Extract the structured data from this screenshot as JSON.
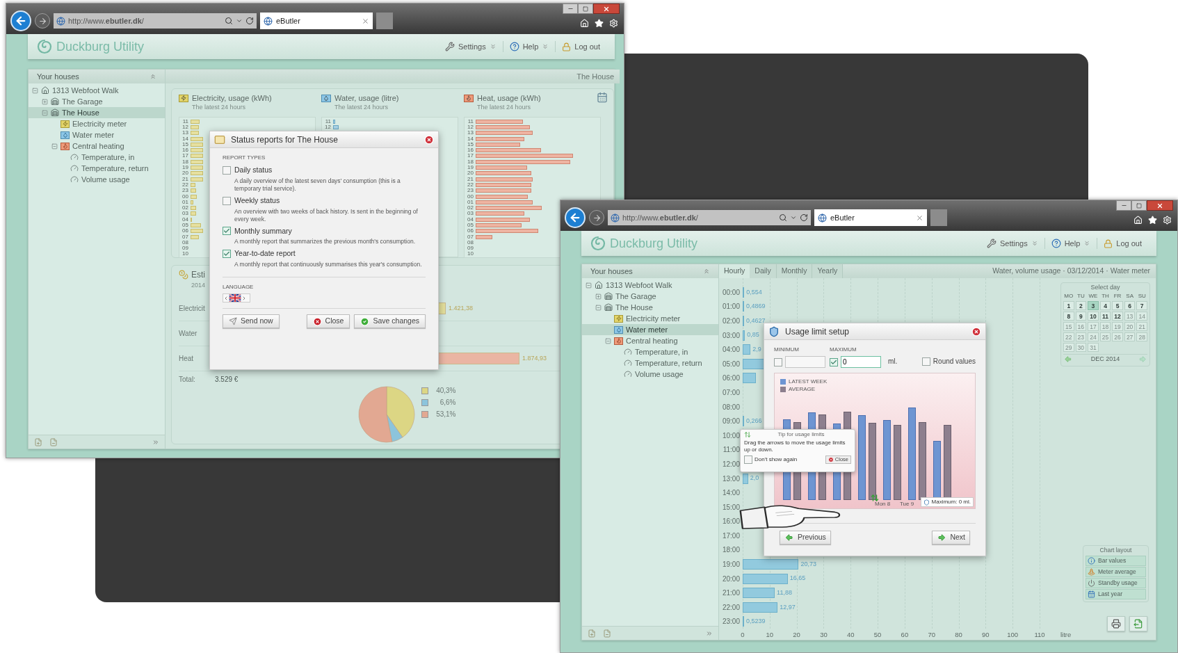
{
  "window_1": {
    "browser": {
      "address": "http://www.**ebutler.dk**/",
      "tab": "eButler"
    },
    "header": {
      "logo": "Duckburg Utility",
      "menu": [
        {
          "label": "Settings",
          "kind": "settings",
          "dropdown": true
        },
        {
          "label": "Help",
          "kind": "help",
          "dropdown": true
        },
        {
          "label": "Log out",
          "kind": "logout",
          "dropdown": false
        }
      ]
    },
    "sidebar": {
      "title": "Your houses",
      "tree": [
        {
          "label": "1313 Webfoot Walk",
          "kind": "house",
          "expanded": true,
          "selected": false,
          "children": [
            {
              "label": "The Garage",
              "kind": "building",
              "expanded": false,
              "selected": false
            },
            {
              "label": "The House",
              "kind": "building",
              "expanded": true,
              "selected": true,
              "children": [
                {
                  "label": "Electricity meter",
                  "kind": "electricity",
                  "selected": false
                },
                {
                  "label": "Water meter",
                  "kind": "water",
                  "selected": false
                },
                {
                  "label": "Central heating",
                  "kind": "heating",
                  "expanded": true,
                  "selected": false,
                  "children": [
                    {
                      "label": "Temperature, in",
                      "kind": "sensor",
                      "selected": false
                    },
                    {
                      "label": "Temperature, return",
                      "kind": "sensor",
                      "selected": false
                    },
                    {
                      "label": "Volume usage",
                      "kind": "sensor",
                      "selected": false
                    }
                  ]
                }
              ]
            }
          ]
        }
      ]
    },
    "title": "The House",
    "usage_charts": [
      {
        "title": "Electricity, usage (kWh)",
        "subtitle": "The latest 24 hours",
        "kind": "electricity",
        "hours": [
          "11",
          "12",
          "13",
          "14",
          "15",
          "16",
          "17",
          "18",
          "19",
          "20",
          "21",
          "22",
          "23",
          "00",
          "01",
          "02",
          "03",
          "04",
          "05",
          "06",
          "07",
          "08",
          "09",
          "10"
        ]
      },
      {
        "title": "Water, usage (litre)",
        "subtitle": "The latest 24 hours",
        "kind": "water",
        "hours": [
          "11",
          "12"
        ]
      },
      {
        "title": "Heat, usage (kWh)",
        "subtitle": "The latest 24 hours",
        "kind": "heat",
        "hours": [
          "11",
          "12",
          "13",
          "14",
          "15",
          "16",
          "17",
          "18",
          "19",
          "20",
          "21",
          "22",
          "23",
          "00",
          "01",
          "02",
          "03",
          "04",
          "05",
          "06",
          "07",
          "08",
          "09",
          "10"
        ]
      }
    ],
    "estimate": {
      "title": "Esti",
      "year": "2014",
      "chart_data": {
        "type": "bar",
        "orientation": "horizontal",
        "categories": [
          "Electricit",
          "Water",
          "Heat"
        ],
        "values": [
          1421.38,
          null,
          1874.93
        ],
        "value_labels": [
          "1.421,38",
          null,
          "1.874,93"
        ],
        "colors": [
          "#e3df9c",
          null,
          "#eab5a3"
        ]
      },
      "total_label": "Total:",
      "total": "3.529 €",
      "pie": {
        "chart_data": {
          "type": "pie",
          "categories": [
            "40,3%",
            "6,6%",
            "53,1%"
          ],
          "values": [
            40.3,
            6.6,
            53.1
          ],
          "legend": "right",
          "colors": [
            "#dcd684",
            "#8cc4dc",
            "#e2a892"
          ]
        }
      }
    },
    "dialog": {
      "title": "Status reports for The House",
      "section": "REPORT TYPES",
      "options": [
        {
          "label": "Daily status",
          "description": "A daily overview of the latest seven days' consumption (this is a temporary trial service).",
          "checked": false
        },
        {
          "label": "Weekly status",
          "description": "An overview with two weeks of back history. Is sent in the beginning of every week.",
          "checked": false
        },
        {
          "label": "Monthly summary",
          "description": "A monthly report that summarizes the previous month's consumption.",
          "checked": true
        },
        {
          "label": "Year-to-date report",
          "description": "A monthly report that continuously summarises this year's consumption.",
          "checked": true
        }
      ],
      "language_label": "LANGUAGE",
      "buttons": [
        {
          "label": "Send now",
          "kind": "send"
        },
        {
          "label": "Close",
          "kind": "close"
        },
        {
          "label": "Save changes",
          "kind": "save"
        }
      ]
    }
  },
  "window_2": {
    "browser": {
      "address": "http://www.**ebutler.dk**/",
      "tab": "eButler"
    },
    "header": {
      "logo": "Duckburg Utility",
      "menu": [
        {
          "label": "Settings",
          "kind": "settings",
          "dropdown": true
        },
        {
          "label": "Help",
          "kind": "help",
          "dropdown": true
        },
        {
          "label": "Log out",
          "kind": "logout",
          "dropdown": false
        }
      ]
    },
    "sidebar": {
      "title": "Your houses",
      "tree": [
        {
          "label": "1313 Webfoot Walk",
          "kind": "house",
          "expanded": true,
          "selected": false,
          "children": [
            {
              "label": "The Garage",
              "kind": "building",
              "expanded": false,
              "selected": false
            },
            {
              "label": "The House",
              "kind": "building",
              "expanded": true,
              "selected": false,
              "children": [
                {
                  "label": "Electricity meter",
                  "kind": "electricity",
                  "selected": false
                },
                {
                  "label": "Water meter",
                  "kind": "water",
                  "selected": true
                },
                {
                  "label": "Central heating",
                  "kind": "heating",
                  "expanded": true,
                  "selected": false,
                  "children": [
                    {
                      "label": "Temperature, in",
                      "kind": "sensor",
                      "selected": false
                    },
                    {
                      "label": "Temperature, return",
                      "kind": "sensor",
                      "selected": false
                    },
                    {
                      "label": "Volume usage",
                      "kind": "sensor",
                      "selected": false
                    }
                  ]
                }
              ]
            }
          ]
        }
      ]
    },
    "tabs": [
      {
        "label": "Hourly",
        "selected": true
      },
      {
        "label": "Daily",
        "selected": false
      },
      {
        "label": "Monthly",
        "selected": false
      },
      {
        "label": "Yearly",
        "selected": false
      }
    ],
    "heading": "Water, volume usage · 03/12/2014 · Water meter",
    "hourly": {
      "chart_data": {
        "type": "bar",
        "orientation": "horizontal",
        "xlabel": "litre",
        "xlim": [
          0,
          110
        ],
        "grid": true,
        "xticks": [
          0,
          10,
          20,
          30,
          40,
          50,
          60,
          70,
          80,
          90,
          100,
          110
        ],
        "categories": [
          "00:00",
          "01:00",
          "02:00",
          "03:00",
          "04:00",
          "05:00",
          "06:00",
          "07:00",
          "08:00",
          "09:00",
          "10:00",
          "11:00",
          "12:00",
          "13:00",
          "14:00",
          "15:00",
          "16:00",
          "17:00",
          "18:00",
          "19:00",
          "20:00",
          "21:00",
          "22:00",
          "23:00"
        ],
        "values": [
          0.554,
          0.4869,
          0.4627,
          0.85,
          2.9,
          8,
          5,
          null,
          null,
          0.266,
          null,
          null,
          null,
          2,
          null,
          null,
          null,
          null,
          null,
          20.73,
          16.65,
          11.88,
          12.97,
          0.5239
        ],
        "value_labels": [
          "0,554",
          "0,4869",
          "0,4627",
          "0,85",
          "2,9",
          null,
          null,
          null,
          null,
          "0,266",
          null,
          null,
          null,
          "2,0",
          null,
          null,
          null,
          null,
          null,
          "20,73",
          "16,65",
          "11,88",
          "12,97",
          "0,5239"
        ]
      }
    },
    "calendar": {
      "title": "Select day",
      "weekdays": [
        "MO",
        "TU",
        "WE",
        "TH",
        "FR",
        "SA",
        "SU"
      ],
      "month": "DEC 2014",
      "days": [
        {
          "label": "1",
          "selected": false,
          "disabled": false
        },
        {
          "label": "2",
          "selected": false,
          "disabled": false
        },
        {
          "label": "3",
          "selected": true,
          "disabled": false
        },
        {
          "label": "4",
          "selected": false,
          "disabled": false
        },
        {
          "label": "5",
          "selected": false,
          "disabled": false
        },
        {
          "label": "6",
          "selected": false,
          "disabled": false
        },
        {
          "label": "7",
          "selected": false,
          "disabled": false
        },
        {
          "label": "8",
          "selected": false,
          "disabled": false
        },
        {
          "label": "9",
          "selected": false,
          "disabled": false
        },
        {
          "label": "10",
          "selected": false,
          "disabled": false
        },
        {
          "label": "11",
          "selected": false,
          "disabled": false
        },
        {
          "label": "12",
          "selected": false,
          "disabled": false
        },
        {
          "label": "13",
          "selected": false,
          "disabled": true
        },
        {
          "label": "14",
          "selected": false,
          "disabled": true
        },
        {
          "label": "15",
          "selected": false,
          "disabled": true
        },
        {
          "label": "16",
          "selected": false,
          "disabled": true
        },
        {
          "label": "17",
          "selected": false,
          "disabled": true
        },
        {
          "label": "18",
          "selected": false,
          "disabled": true
        },
        {
          "label": "19",
          "selected": false,
          "disabled": true
        },
        {
          "label": "20",
          "selected": false,
          "disabled": true
        },
        {
          "label": "21",
          "selected": false,
          "disabled": true
        },
        {
          "label": "22",
          "selected": false,
          "disabled": true
        },
        {
          "label": "23",
          "selected": false,
          "disabled": true
        },
        {
          "label": "24",
          "selected": false,
          "disabled": true
        },
        {
          "label": "25",
          "selected": false,
          "disabled": true
        },
        {
          "label": "26",
          "selected": false,
          "disabled": true
        },
        {
          "label": "27",
          "selected": false,
          "disabled": true
        },
        {
          "label": "28",
          "selected": false,
          "disabled": true
        },
        {
          "label": "29",
          "selected": false,
          "disabled": true
        },
        {
          "label": "30",
          "selected": false,
          "disabled": true
        },
        {
          "label": "31",
          "selected": false,
          "disabled": true
        }
      ]
    },
    "chart_layout": {
      "title": "Chart layout",
      "items": [
        {
          "label": "Bar values",
          "kind": "bar-values"
        },
        {
          "label": "Meter average",
          "kind": "meter-average"
        },
        {
          "label": "Standby usage",
          "kind": "standby"
        },
        {
          "label": "Last year",
          "kind": "last-year"
        }
      ]
    },
    "dialog": {
      "title": "Usage limit setup",
      "minimum": {
        "label": "MINIMUM",
        "checked": false
      },
      "maximum": {
        "label": "MAXIMUM",
        "checked": true,
        "value": "0"
      },
      "unit": "ml.",
      "round_values": {
        "label": "Round values",
        "checked": false
      },
      "legend": [
        {
          "label": "LATEST WEEK",
          "color": "#6e95d2"
        },
        {
          "label": "AVERAGE",
          "color": "#8d7f8e"
        }
      ],
      "days": [
        "Mon 8",
        "Tue 9"
      ],
      "limit_badge": "Maximum: 0 ml.",
      "buttons": [
        {
          "label": "Previous",
          "kind": "previous"
        },
        {
          "label": "Next",
          "kind": "next"
        }
      ]
    },
    "tip": {
      "title": "Tip for usage limits",
      "text": "Drag the arrows to move the usage limits up or down.",
      "dont_show": {
        "label": "Don't show again",
        "checked": false
      },
      "close": "Close"
    }
  }
}
